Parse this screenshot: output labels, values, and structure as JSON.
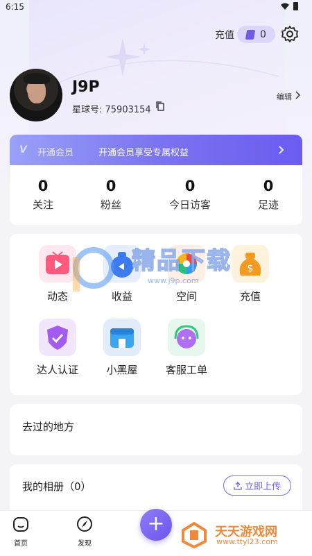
{
  "status_bar": {
    "time": "6:15"
  },
  "header": {
    "recharge_label": "充值",
    "coin_count": "0"
  },
  "profile": {
    "name": "J9P",
    "id_label": "星球号: ",
    "id_value": "75903154",
    "edit_label": "编辑"
  },
  "vip": {
    "title": "开通会员",
    "promo": "开通会员享受专属权益"
  },
  "stats": [
    {
      "value": "0",
      "label": "关注"
    },
    {
      "value": "0",
      "label": "粉丝"
    },
    {
      "value": "0",
      "label": "今日访客"
    },
    {
      "value": "0",
      "label": "足迹"
    }
  ],
  "tiles": [
    {
      "label": "动态",
      "icon": "video-play-icon"
    },
    {
      "label": "收益",
      "icon": "money-bag-icon"
    },
    {
      "label": "空间",
      "icon": "color-wheel-icon"
    },
    {
      "label": "充值",
      "icon": "dollar-bag-icon"
    },
    {
      "label": "达人认证",
      "icon": "shield-badge-icon"
    },
    {
      "label": "小黑屋",
      "icon": "shop-icon"
    },
    {
      "label": "客服工单",
      "icon": "headset-mascot-icon"
    }
  ],
  "places": {
    "title": "去过的地方"
  },
  "album": {
    "title": "我的相册（0）",
    "upload_label": "立即上传"
  },
  "tabbar": {
    "home_label": "首页",
    "discover_label": "发现"
  },
  "watermarks": {
    "center_text": "精品下载",
    "center_url": "www.j9p.com",
    "brand_text": "天天游戏网",
    "brand_url": "www.ttyl23.com"
  },
  "colors": {
    "accent": "#6c55ee",
    "vip_start": "#9aa1f7",
    "vip_end": "#6a5cf0"
  }
}
